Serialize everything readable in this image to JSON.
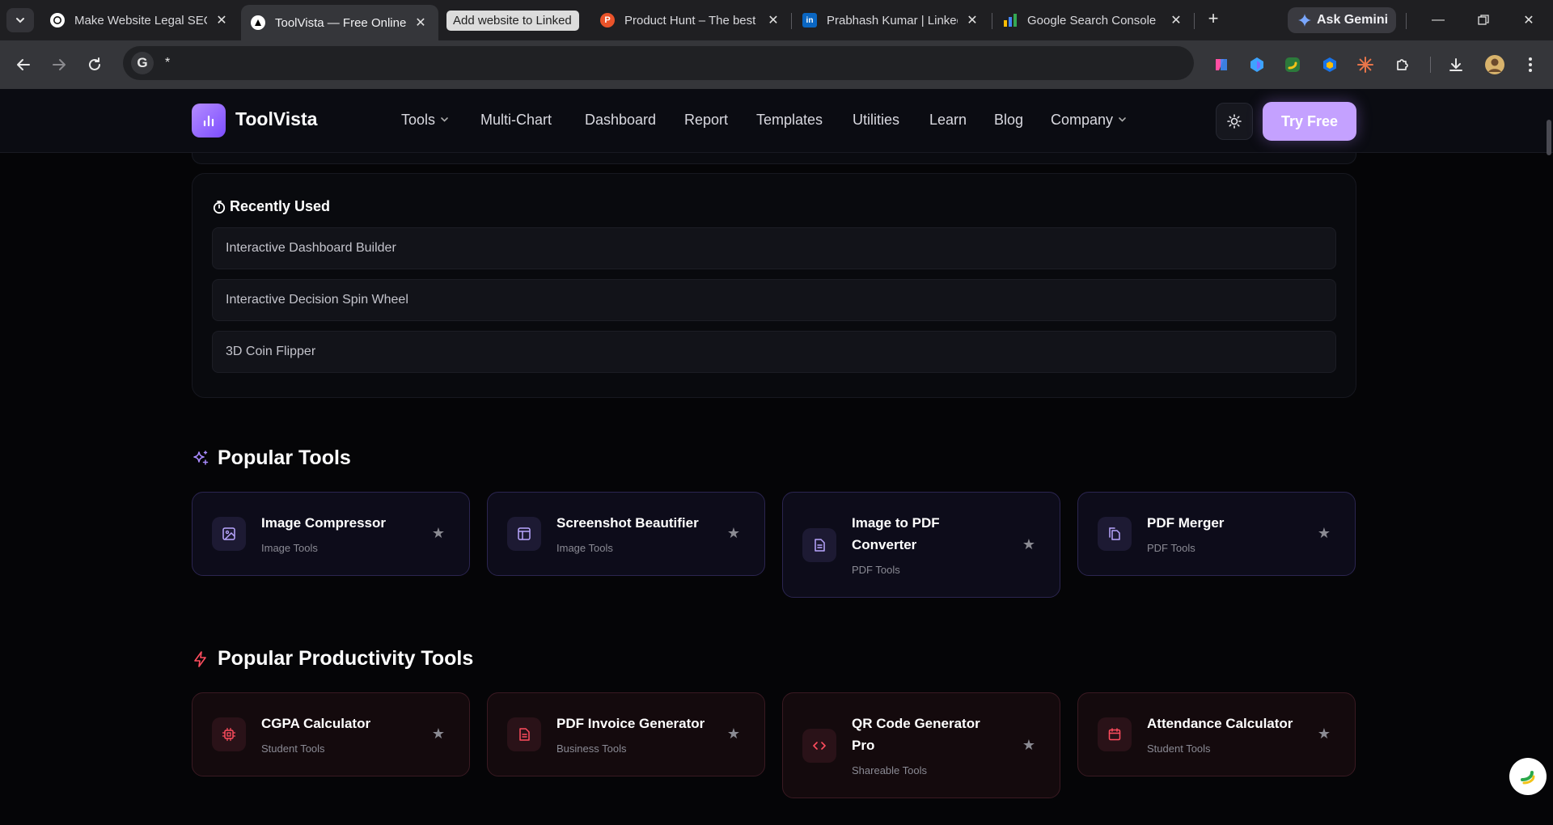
{
  "browser": {
    "tabs": [
      {
        "title": "Make Website Legal SEO",
        "favicon": "openai-icon",
        "active": false
      },
      {
        "title": "ToolVista — Free Online",
        "favicon": "vercel-triangle-icon",
        "active": true
      },
      {
        "title": "Add website to Linked",
        "favicon": "",
        "active": false
      },
      {
        "title": "Product Hunt – The best",
        "favicon": "producthunt-icon",
        "active": false
      },
      {
        "title": "Prabhash Kumar | Linked",
        "favicon": "linkedin-icon",
        "active": false
      },
      {
        "title": "Google Search Console",
        "favicon": "search-console-icon",
        "active": false
      }
    ],
    "favicon_letters": {
      "producthunt": "P",
      "linkedin": "in"
    },
    "ask_gemini": "Ask Gemini",
    "address": "*",
    "address_g": "G"
  },
  "site": {
    "brand": "ToolVista",
    "nav": {
      "tools": "Tools",
      "multichart": "Multi-Chart",
      "dashboard": "Dashboard",
      "report": "Report",
      "templates": "Templates",
      "utilities": "Utilities",
      "learn": "Learn",
      "blog": "Blog",
      "company": "Company"
    },
    "try_free": "Try Free",
    "accent": "#c4a1ff"
  },
  "recent": {
    "title": "Recently Used",
    "items": [
      "Interactive Dashboard Builder",
      "Interactive Decision Spin Wheel",
      "3D Coin Flipper"
    ]
  },
  "popular_tools": {
    "title": "Popular Tools",
    "cards": [
      {
        "title": "Image Compressor",
        "category": "Image Tools",
        "icon": "image-icon"
      },
      {
        "title": "Screenshot Beautifier",
        "category": "Image Tools",
        "icon": "layout-icon"
      },
      {
        "title": "Image to PDF Converter",
        "category": "PDF Tools",
        "icon": "file-text-icon"
      },
      {
        "title": "PDF Merger",
        "category": "PDF Tools",
        "icon": "copy-files-icon"
      }
    ]
  },
  "productivity_tools": {
    "title": "Popular Productivity Tools",
    "cards": [
      {
        "title": "CGPA Calculator",
        "category": "Student Tools",
        "icon": "cpu-icon"
      },
      {
        "title": "PDF Invoice Generator",
        "category": "Business Tools",
        "icon": "invoice-icon"
      },
      {
        "title": "QR Code Generator Pro",
        "category": "Shareable Tools",
        "icon": "code-icon"
      },
      {
        "title": "Attendance Calculator",
        "category": "Student Tools",
        "icon": "calendar-icon"
      }
    ]
  }
}
